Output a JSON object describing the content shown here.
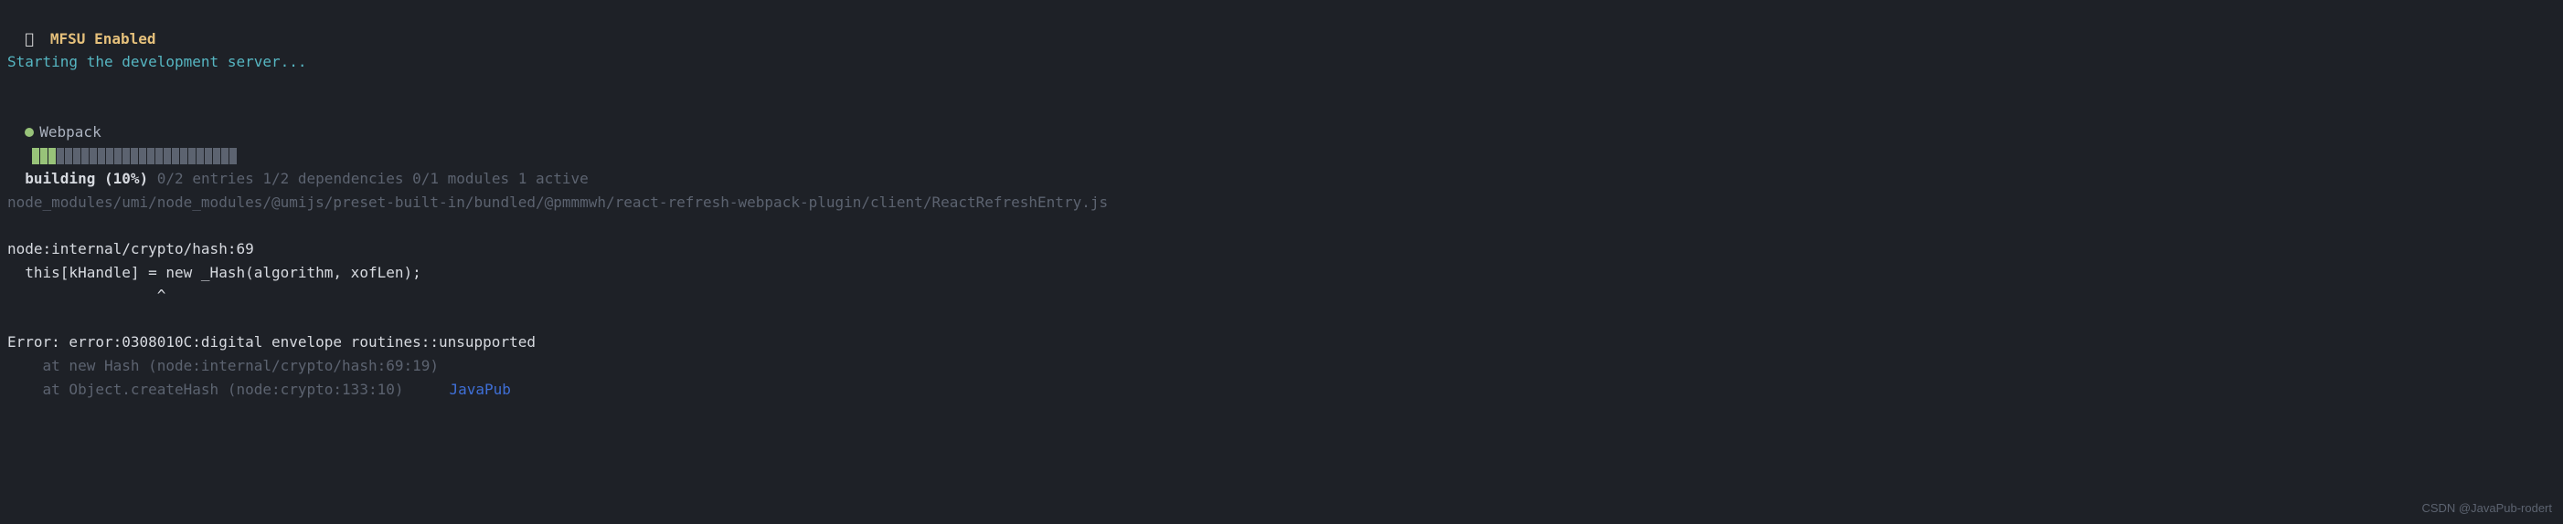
{
  "header": {
    "mfsu_label": "MFSU Enabled"
  },
  "starting_line": "Starting the development server...",
  "webpack": {
    "label": "Webpack",
    "building_label": "building",
    "percent": "(10%)",
    "entries_info": "0/2 entries 1/2 dependencies 0/1 modules 1 active",
    "progress_filled": 3,
    "progress_total": 25,
    "module_path": "node_modules/umi/node_modules/@umijs/preset-built-in/bundled/@pmmmwh/react-refresh-webpack-plugin/client/ReactRefreshEntry.js"
  },
  "node_error": {
    "location": "node:internal/crypto/hash:69",
    "code_line": "  this[kHandle] = new _Hash(algorithm, xofLen);",
    "pointer_line": "                 ^"
  },
  "error": {
    "message": "Error: error:0308010C:digital envelope routines::unsupported",
    "stack": [
      "    at new Hash (node:internal/crypto/hash:69:19)",
      "    at Object.createHash (node:crypto:133:10)"
    ]
  },
  "watermark": "JavaPub",
  "csdn": "CSDN @JavaPub-rodert"
}
